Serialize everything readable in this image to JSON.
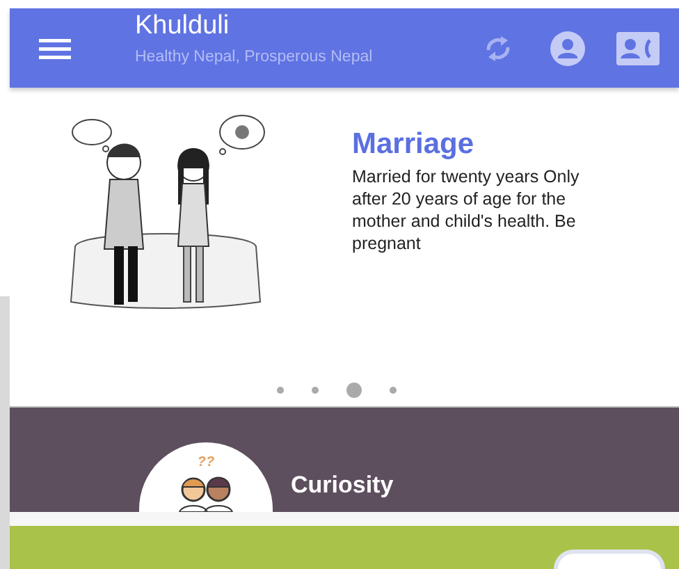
{
  "app_bar": {
    "title": "Khulduli",
    "subtitle": "Healthy Nepal, Prosperous Nepal"
  },
  "slide": {
    "title": "Marriage",
    "text": "Married for twenty years Only after 20 years of age for the mother and child's health. Be pregnant"
  },
  "slide_dots": [
    {
      "selected": false
    },
    {
      "selected": false
    },
    {
      "selected": true
    },
    {
      "selected": false
    }
  ],
  "category": {
    "title": "Curiosity",
    "icon_mark": "??"
  }
}
